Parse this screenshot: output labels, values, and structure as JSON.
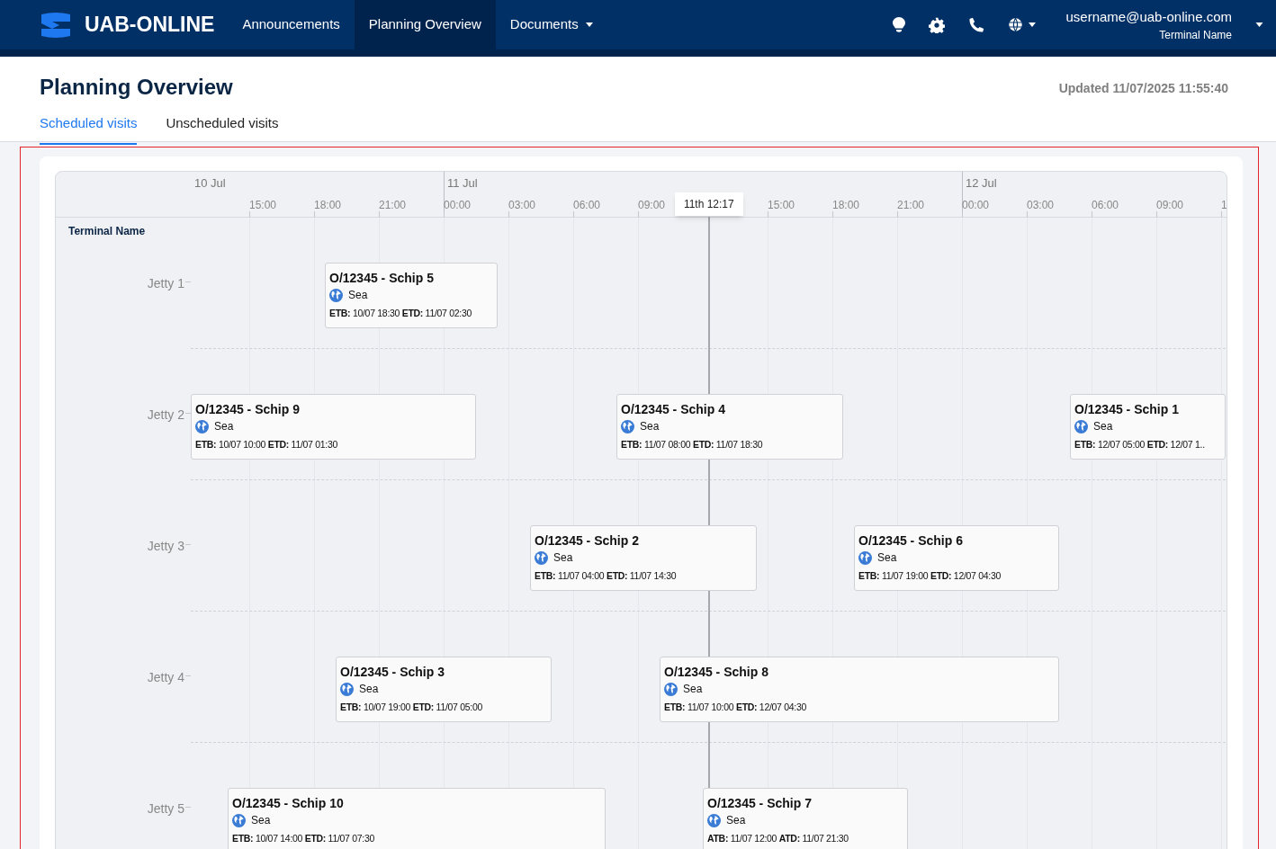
{
  "nav": {
    "brand": "UAB-ONLINE",
    "items": [
      {
        "label": "Announcements",
        "selected": false,
        "dropdown": false
      },
      {
        "label": "Planning Overview",
        "selected": true,
        "dropdown": false
      },
      {
        "label": "Documents",
        "selected": false,
        "dropdown": true
      }
    ],
    "user": {
      "email": "username@uab-online.com",
      "terminal": "Terminal Name"
    }
  },
  "page": {
    "title": "Planning Overview",
    "updated": "Updated 11/07/2025 11:55:40",
    "tabs": [
      {
        "label": "Scheduled visits",
        "selected": true
      },
      {
        "label": "Unscheduled visits",
        "selected": false
      }
    ]
  },
  "timeline": {
    "row_header": "Terminal Name",
    "days": [
      "10 Jul",
      "11 Jul",
      "12 Jul"
    ],
    "ticks": [
      "15:00",
      "18:00",
      "21:00",
      "00:00",
      "03:00",
      "06:00",
      "09:00",
      "15:00",
      "18:00",
      "21:00",
      "00:00",
      "03:00",
      "06:00",
      "09:00",
      "1"
    ],
    "now_label": "11th 12:17",
    "rows": [
      {
        "label": "Jetty 1",
        "visits": [
          {
            "title": "O/12345 - Schip 5",
            "mode": "Sea",
            "times": "**ETB:** 10/07 18:30 **ETD:** 11/07 02:30"
          }
        ]
      },
      {
        "label": "Jetty 2",
        "visits": [
          {
            "title": "O/12345 - Schip 9",
            "mode": "Sea",
            "times": "**ETB:** 10/07 10:00 **ETD:** 11/07 01:30"
          },
          {
            "title": "O/12345 - Schip 4",
            "mode": "Sea",
            "times": "**ETB:** 11/07 08:00 **ETD:** 11/07 18:30"
          },
          {
            "title": "O/12345 - Schip 1",
            "mode": "Sea",
            "times": "**ETB:** 12/07 05:00 **ETD:** 12/07 1.."
          }
        ]
      },
      {
        "label": "Jetty 3",
        "visits": [
          {
            "title": "O/12345 - Schip 2",
            "mode": "Sea",
            "times": "**ETB:** 11/07 04:00 **ETD:** 11/07 14:30"
          },
          {
            "title": "O/12345 - Schip 6",
            "mode": "Sea",
            "times": "**ETB:** 11/07 19:00 **ETD:** 12/07 04:30"
          }
        ]
      },
      {
        "label": "Jetty 4",
        "visits": [
          {
            "title": "O/12345 - Schip 3",
            "mode": "Sea",
            "times": "**ETB:** 10/07 19:00 **ETD:** 11/07 05:00"
          },
          {
            "title": "O/12345 - Schip 8",
            "mode": "Sea",
            "times": "**ETB:** 11/07 10:00 **ETD:** 12/07 04:30"
          }
        ]
      },
      {
        "label": "Jetty 5",
        "visits": [
          {
            "title": "O/12345 - Schip 10",
            "mode": "Sea",
            "times": "**ETB:** 10/07 14:00 **ETD:** 11/07 07:30"
          },
          {
            "title": "O/12345 - Schip 7",
            "mode": "Sea",
            "times": "**ATB:** 11/07 12:00 **ATD:** 11/07 21:30"
          }
        ]
      }
    ]
  }
}
